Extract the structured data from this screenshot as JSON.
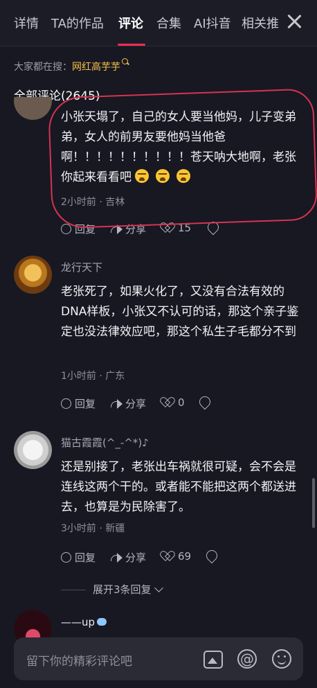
{
  "tabs": {
    "items": [
      {
        "label": "详情"
      },
      {
        "label": "TA的作品"
      },
      {
        "label": "评论"
      },
      {
        "label": "合集"
      },
      {
        "label": "AI抖音"
      },
      {
        "label": "相关推"
      }
    ],
    "active_index": 2
  },
  "search_hint": {
    "prefix": "大家都在搜：",
    "keyword": "网红高芋芋"
  },
  "comments_header": {
    "label": "全部评论(2645)"
  },
  "comments": [
    {
      "text": "小张天塌了，自己的女人要当他妈，儿子变弟弟，女人的前男友要他妈当他爸啊！！！！！！！！！！苍天呐大地啊，老张你起来看看吧",
      "emoji": [
        "loudly-crying-face-emoji",
        "loudly-crying-face-emoji",
        "loudly-crying-face-emoji"
      ],
      "meta": "2小时前 · 吉林",
      "reply_label": "回复",
      "share_label": "分享",
      "likes": "15"
    },
    {
      "nickname": "龙行天下",
      "text": "老张死了，如果火化了，又没有合法有效的DNA样板，小张又不认可的话，那这个亲子鉴定也没法律效应吧，那这个私生子毛都分不到",
      "meta": "1小时前 · 广东",
      "reply_label": "回复",
      "share_label": "分享",
      "likes": "0"
    },
    {
      "nickname": "猫古霞霞(^_-^*)♪",
      "text": "还是别接了，老张出车祸就很可疑，会不会是连线这两个干的。或者能不能把这两个都送进去，也算是为民除害了。",
      "meta": "3小时前 · 新疆",
      "reply_label": "回复",
      "share_label": "分享",
      "likes": "69",
      "expand_label": "展开3条回复"
    },
    {
      "nickname": "——up"
    }
  ],
  "input_bar": {
    "placeholder": "留下你的精彩评论吧"
  },
  "colors": {
    "background": "#171822",
    "accent": "#fe2c55",
    "highlight": "#f6c14a",
    "annotation": "#d83350"
  }
}
